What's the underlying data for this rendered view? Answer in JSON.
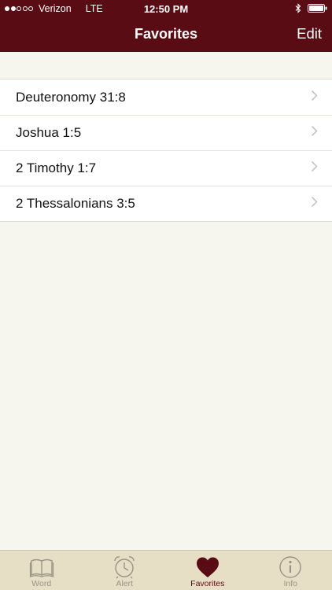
{
  "status_bar": {
    "carrier": "Verizon",
    "network": "LTE",
    "time": "12:50 PM"
  },
  "nav": {
    "title": "Favorites",
    "edit_label": "Edit"
  },
  "favorites": [
    {
      "label": "Deuteronomy 31:8"
    },
    {
      "label": "Joshua 1:5"
    },
    {
      "label": "2 Timothy 1:7"
    },
    {
      "label": "2 Thessalonians 3:5"
    }
  ],
  "tabs": [
    {
      "label": "Word",
      "icon": "book-icon",
      "active": false
    },
    {
      "label": "Alert",
      "icon": "alarm-clock-icon",
      "active": false
    },
    {
      "label": "Favorites",
      "icon": "heart-icon",
      "active": true
    },
    {
      "label": "Info",
      "icon": "info-icon",
      "active": false
    }
  ],
  "colors": {
    "accent": "#5a0c14",
    "background": "#f6f5ee",
    "tab_bar": "#e6dfc6",
    "inactive": "#9a9385"
  }
}
